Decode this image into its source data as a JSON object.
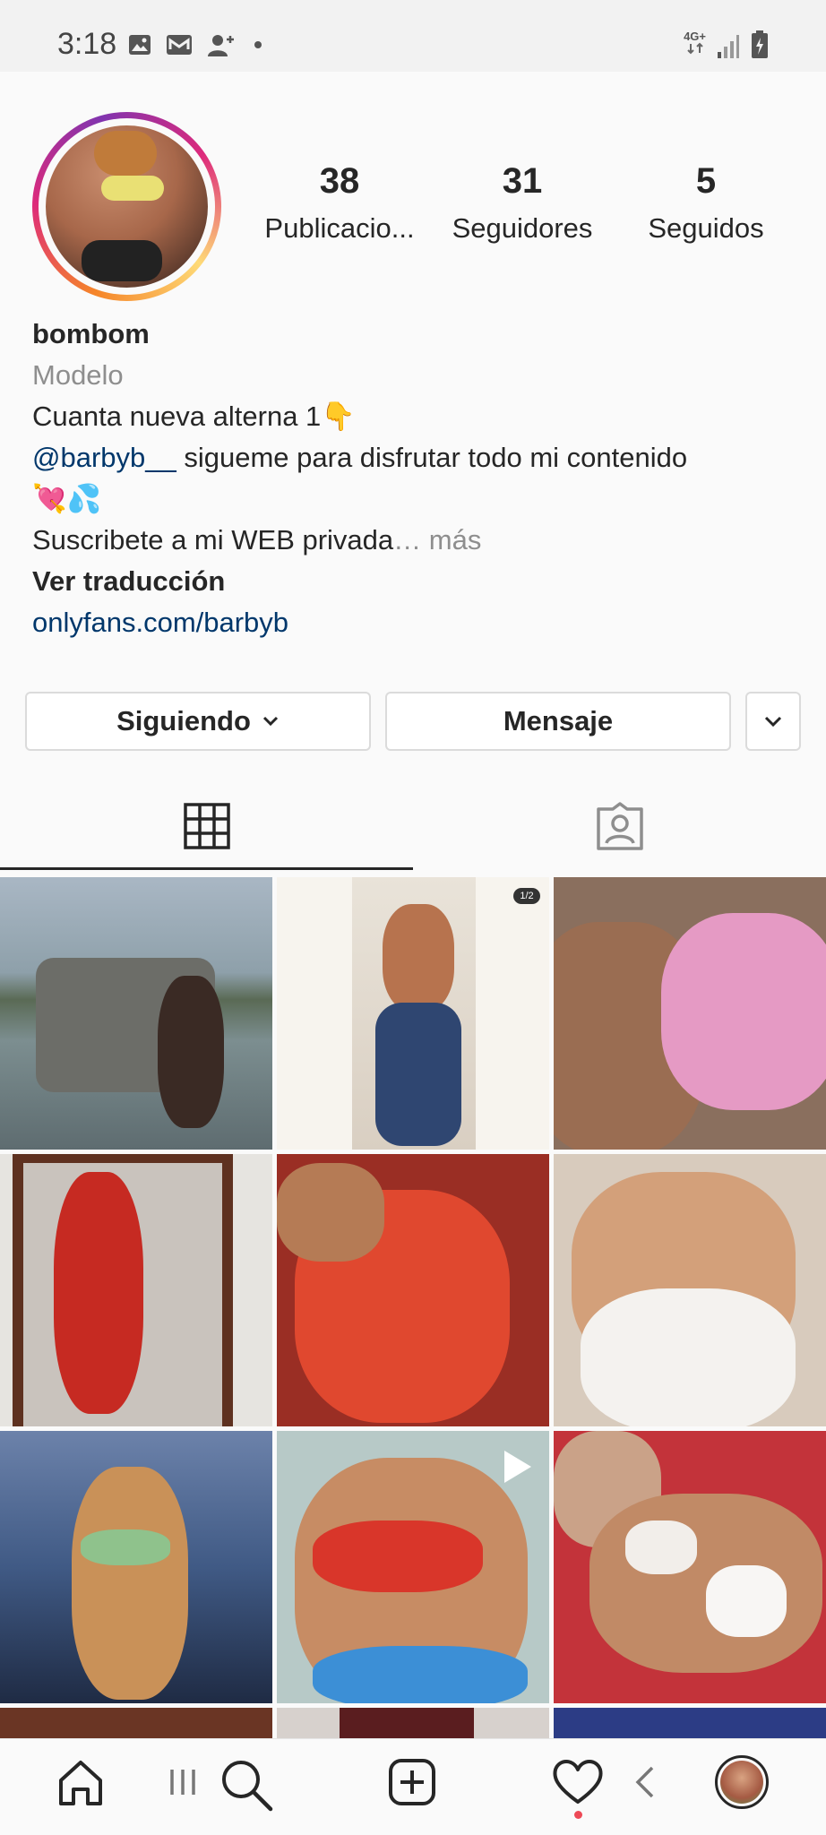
{
  "status_bar": {
    "time": "3:18",
    "network": "4G+",
    "left_icons": [
      "gallery-icon",
      "mail-icon",
      "add-person-icon",
      "dot-icon"
    ],
    "right_icons": [
      "network-icon",
      "signal-icon",
      "battery-icon"
    ]
  },
  "profile": {
    "stats": [
      {
        "value": "38",
        "label": "Publicacio..."
      },
      {
        "value": "31",
        "label": "Seguidores"
      },
      {
        "value": "5",
        "label": "Seguidos"
      }
    ],
    "name": "bombom",
    "category": "Modelo",
    "bio_line1": "Cuanta nueva alterna 1👇",
    "bio_mention": "@barbyb__",
    "bio_line2_rest": " sigueme para disfrutar todo mi contenido",
    "bio_line3": "💘💦",
    "bio_line4": "Suscribete a mi WEB privada",
    "more": "… más",
    "see_translation": "Ver traducción",
    "website": "onlyfans.com/barbyb"
  },
  "actions": {
    "following": "Siguiendo",
    "message": "Mensaje"
  },
  "tabs": [
    "grid-icon",
    "tagged-icon"
  ],
  "grid_badges": {
    "carousel_counter": "1/2"
  },
  "bottom_nav": [
    "home-icon",
    "search-icon",
    "new-post-icon",
    "activity-icon",
    "profile-avatar"
  ],
  "system_nav": [
    "recents-icon",
    "back-icon"
  ],
  "colors": {
    "link": "#00376b",
    "muted": "#8e8e8e",
    "notification": "#ed4956"
  }
}
